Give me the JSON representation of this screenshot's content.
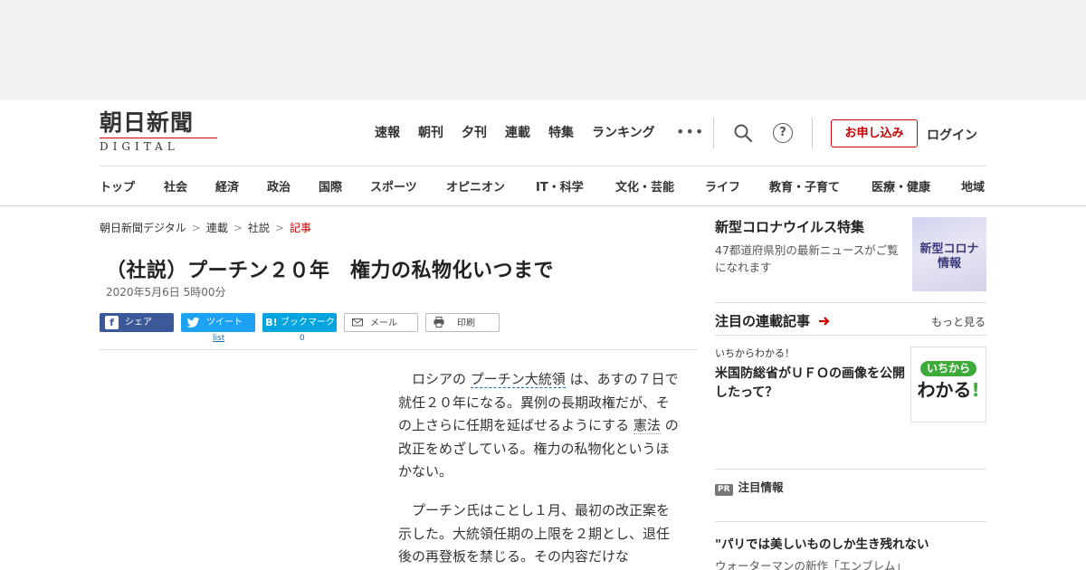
{
  "site": {
    "logo_jp": "朝日新聞",
    "logo_en": "DIGITAL"
  },
  "topnav": [
    "速報",
    "朝刊",
    "夕刊",
    "連載",
    "特集",
    "ランキング"
  ],
  "more_label": "•••",
  "help_label": "?",
  "apply_label": "お申し込み",
  "login_label": "ログイン",
  "categories": [
    "トップ",
    "社会",
    "経済",
    "政治",
    "国際",
    "スポーツ",
    "オピニオン",
    "IT・科学",
    "文化・芸能",
    "ライフ",
    "教育・子育て",
    "医療・健康",
    "地域"
  ],
  "breadcrumb": [
    "朝日新聞デジタル",
    "連載",
    "社説",
    "記事"
  ],
  "breadcrumb_sep": ">",
  "article": {
    "title": "（社説）プーチン２０年　権力の私物化いつまで",
    "date": "2020年5月6日 5時00分",
    "share": {
      "facebook": "シェア",
      "twitter": "ツイート",
      "hatena": "ブックマーク",
      "mail": "メール",
      "print": "印刷",
      "twitter_sub": "list",
      "hatena_count": "0"
    },
    "p1_a": "ロシアの ",
    "p1_link": "プーチン大統領",
    "p1_b": " は、あすの７日で就任２０年になる。異例の長期政権だが、その上さらに任期を延ばせるようにする ",
    "p1_link2": "憲法",
    "p1_c": " の改正をめざしている。権力の私物化というほかない。",
    "p2": "プーチン氏はことし１月、最初の改正案を示した。大統領任期の上限を２期とし、退任後の再登板を禁じる。その内容だけな"
  },
  "sidebar": {
    "corona": {
      "title": "新型コロナウイルス特集",
      "desc": "47都道府県別の最新ニュースがご覧になれます",
      "thumb_l1": "新型コロナ",
      "thumb_l2": "情報"
    },
    "series": {
      "title": "注目の連載記事",
      "more": "もっと見る",
      "kicker": "いちからわかる！",
      "headline": "米国防総省がＵＦＯの画像を公開したって？",
      "thumb_l1": "いちから",
      "thumb_l2": "わかる",
      "thumb_l3": "!"
    },
    "pr": {
      "badge": "PR",
      "label": "注目情報"
    },
    "promo": {
      "title": "\"パリでは美しいものしか生き残れない",
      "desc": "ウォーターマンの新作「エンブレム」"
    }
  },
  "colors": {
    "brand_red": "#cc0000",
    "facebook": "#3b5998",
    "twitter": "#1da1f2",
    "hatena": "#00a4de"
  }
}
